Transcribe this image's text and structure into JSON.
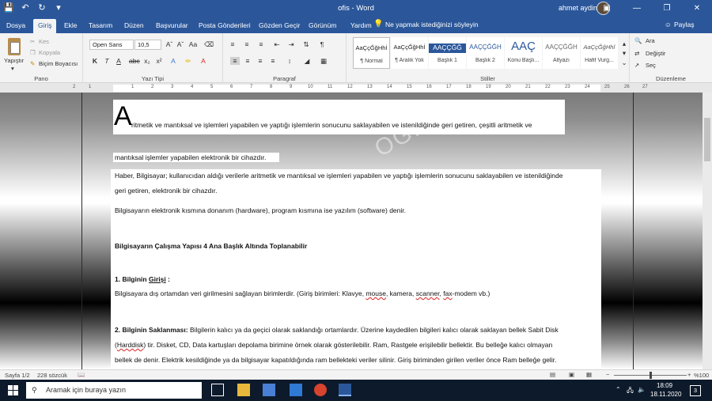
{
  "window": {
    "title": "ofis  -  Word",
    "user": "ahmet aydin",
    "share": "Paylaş",
    "tell_me": "Ne yapmak istediğinizi söyleyin"
  },
  "tabs": [
    "Dosya",
    "Giriş",
    "Ekle",
    "Tasarım",
    "Düzen",
    "Başvurular",
    "Posta Gönderileri",
    "Gözden Geçir",
    "Görünüm",
    "Yardım"
  ],
  "clipboard": {
    "paste": "Yapıştır",
    "cut": "Kes",
    "copy": "Kopyala",
    "format_painter": "Biçim Boyacısı",
    "label": "Pano"
  },
  "font": {
    "name": "Open Sans",
    "size": "10,5",
    "label": "Yazı Tipi"
  },
  "paragraph": {
    "label": "Paragraf"
  },
  "styles": {
    "label": "Stiller",
    "items": [
      {
        "preview": "AaÇçĞğHhİ",
        "name": "¶ Normal"
      },
      {
        "preview": "AaÇçĞğHhİ",
        "name": "¶ Aralık Yok"
      },
      {
        "preview": "AAÇÇĞĞ",
        "name": "Başlık 1"
      },
      {
        "preview": "AAÇÇĞĞH",
        "name": "Başlık 2"
      },
      {
        "preview": "AAÇ",
        "name": "Konu Başlı..."
      },
      {
        "preview": "AAÇÇĞĞH",
        "name": "Altyazı"
      },
      {
        "preview": "AaÇçĞğHhİ",
        "name": "Hafif Vurg..."
      }
    ]
  },
  "editing": {
    "find": "Ara",
    "replace": "Değiştir",
    "select": "Seç",
    "label": "Düzenleme"
  },
  "document": {
    "drop_cap": "A",
    "p1_line1": "ritmetik ve mantıksal ve işlemleri yapabilen ve yaptığı işlemlerin sonucunu saklayabilen ve istenildiğinde geri getiren, çeşitli aritmetik ve",
    "p1_line2": "mantıksal işlemler yapabilen elektronik bir cihazdır.",
    "p2_line1": "Haber, Bilgisayar; kullanıcıdan aldığı verilerle aritmetik ve mantıksal ve işlemleri yapabilen ve yaptığı işlemlerin sonucunu saklayabilen ve istenildiğinde",
    "p2_line2": "geri getiren, elektronik bir cihazdır.",
    "p3": "Bilgisayarın elektronik kısmına donanım (hardware), program kısmına ise yazılım (software) denir.",
    "heading": "Bilgisayarın Çalışma Yapısı 4 Ana Başlık Altında Toplanabilir",
    "s1_title_a": "1. Bilginin ",
    "s1_title_b": "Girişi",
    "s1_title_c": " :",
    "s1_text_a": "Bilgisayara dış ortamdan veri girilmesini sağlayan birimlerdir. (Giriş birimleri: Klavye, ",
    "s1_mouse": "mouse",
    "s1_text_b": ", kamera, ",
    "s1_scanner": "scanner",
    "s1_text_c": ", ",
    "s1_fax": "fax",
    "s1_text_d": "-modem vb.)",
    "s2_title": "2. Bilginin Saklanması:",
    "s2_line1": " Bilgilerin kalıcı ya da geçici olarak saklandığı ortamlardır. Üzerine kaydedilen bilgileri kalıcı olarak saklayan bellek Sabit Disk",
    "s2_line2_a": "(",
    "s2_hdd": "Harddisk",
    "s2_line2_b": ") tir. Disket, CD, Data kartuşları depolama birimine örnek olarak gösterilebilir. Ram, Rastgele erişilebilir bellektir. Bu belleğe kalıcı olmayan",
    "s2_line3": "bellek de denir. Elektrik kesildiğinde ya da bilgisayar kapatıldığında ram bellekteki veriler silinir. Giriş biriminden girilen veriler önce Ram belleğe gelir.",
    "watermark": "OGRA"
  },
  "status": {
    "page": "Sayfa 1/2",
    "words": "228 sözcük",
    "zoom": "%100",
    "zoom_fraction": 0.5
  },
  "taskbar": {
    "search": "Aramak için buraya yazın",
    "time": "18:09",
    "date": "18.11.2020",
    "notifications": "3"
  },
  "colors": {
    "accent": "#2b579a",
    "taskbar": "#0d1a2b",
    "style_highlight": "#2b579a"
  }
}
